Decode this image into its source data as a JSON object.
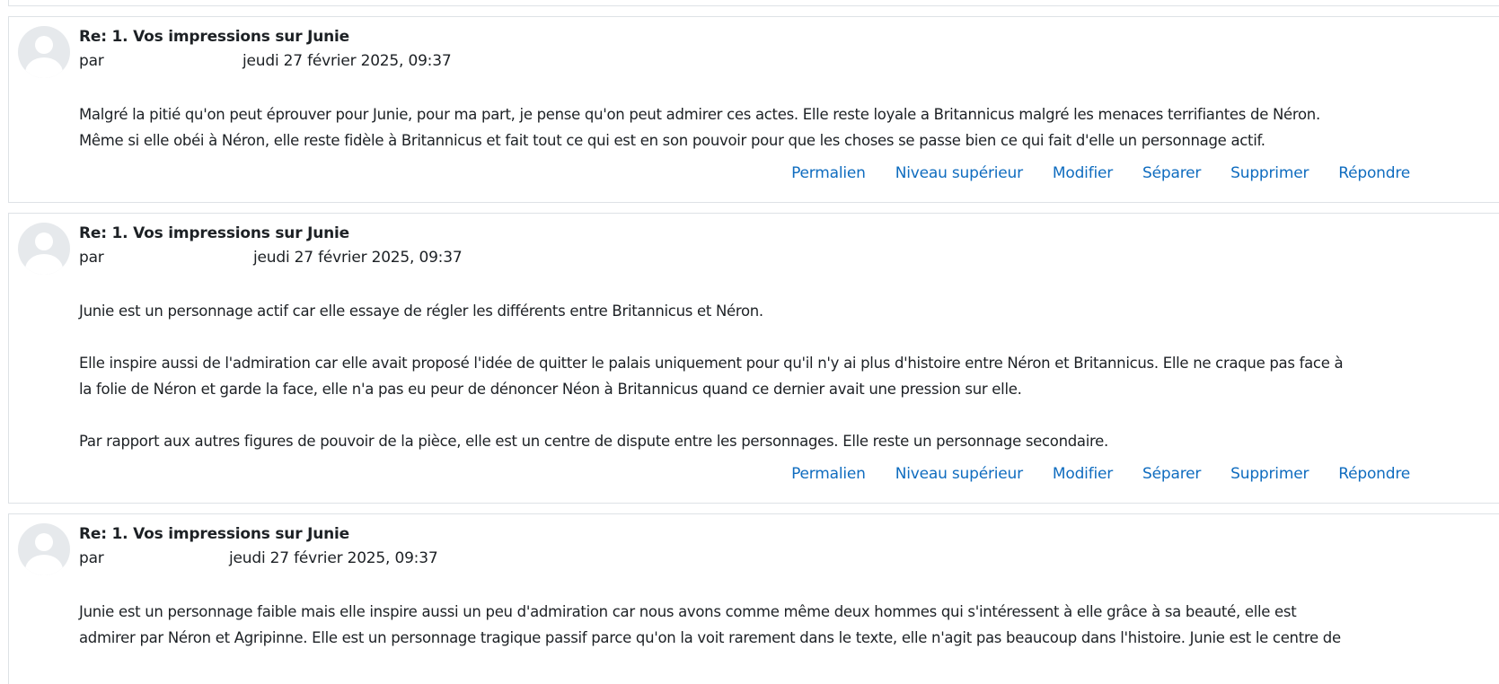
{
  "posts": [
    {
      "subject": "Re: 1. Vos impressions sur Junie",
      "by_label": "par",
      "date": "jeudi 27 février 2025, 09:37",
      "paragraphs": [
        [
          "Malgré la pitié qu'on peut éprouver pour Junie, pour ma part, je pense qu'on peut admirer ces actes. Elle reste loyale a Britannicus malgré les menaces terrifiantes de Néron.",
          "Même si elle obéi à Néron, elle reste fidèle à Britannicus et fait tout ce qui est en son pouvoir pour que les choses se passe bien ce qui fait d'elle un personnage actif."
        ]
      ]
    },
    {
      "subject": "Re: 1. Vos impressions sur Junie",
      "by_label": "par",
      "date": "jeudi 27 février 2025, 09:37",
      "paragraphs": [
        [
          "Junie est un personnage actif car elle essaye de régler les différents entre Britannicus et Néron."
        ],
        [
          "Elle inspire aussi de l'admiration car elle avait proposé l'idée de quitter le palais uniquement pour qu'il n'y ai plus d'histoire entre Néron et Britannicus. Elle ne craque pas face à",
          "la folie de Néron et garde la face, elle n'a pas eu peur de dénoncer Néon à Britannicus quand ce dernier avait une pression sur elle."
        ],
        [
          "Par rapport aux autres figures de pouvoir de la pièce, elle est un centre de dispute entre les personnages. Elle reste un personnage secondaire."
        ]
      ]
    },
    {
      "subject": "Re: 1. Vos impressions sur Junie",
      "by_label": "par",
      "date": "jeudi 27 février 2025, 09:37",
      "paragraphs": [
        [
          "Junie est un personnage faible mais elle inspire aussi un peu d'admiration car nous avons comme même deux hommes qui s'intéressent à elle grâce à sa beauté, elle est",
          "admirer par Néron et Agripinne. Elle est un personnage tragique passif parce qu'on la voit rarement dans le texte, elle n'agit pas beaucoup dans l'histoire. Junie est le centre de"
        ]
      ]
    }
  ],
  "commands": {
    "permalink": "Permalien",
    "parent": "Niveau supérieur",
    "edit": "Modifier",
    "split": "Séparer",
    "delete": "Supprimer",
    "reply": "Répondre"
  },
  "icons": {
    "avatar": "default-user-avatar-icon"
  },
  "colors": {
    "link": "#0f6cbf",
    "border": "#dee2e6",
    "avatar_bg": "#e6e9ec",
    "text": "#1d2125"
  }
}
